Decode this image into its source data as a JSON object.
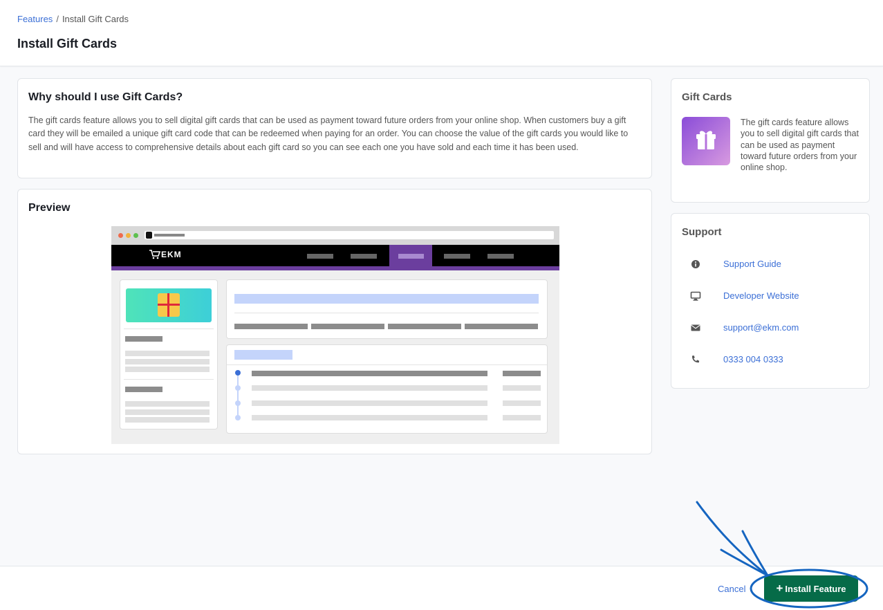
{
  "breadcrumb": {
    "parent": "Features",
    "separator": "/",
    "current": "Install Gift Cards"
  },
  "page_title": "Install Gift Cards",
  "why": {
    "title": "Why should I use Gift Cards?",
    "body": "The gift cards feature allows you to sell digital gift cards that can be used as payment toward future orders from your online shop. When customers buy a gift card they will be emailed a unique gift card code that can be redeemed when paying for an order. You can choose the value of the gift cards you would like to sell and will have access to comprehensive details about each gift card so you can see each one you have sold and each time it has been used."
  },
  "preview": {
    "title": "Preview",
    "logo_text": "⬚EKM"
  },
  "feature_card": {
    "title": "Gift Cards",
    "description": "The gift cards feature allows you to sell digital gift cards that can be used as payment toward future orders from your online shop.",
    "icon": "gift-icon"
  },
  "support": {
    "title": "Support",
    "items": [
      {
        "icon": "info-icon",
        "label": "Support Guide"
      },
      {
        "icon": "monitor-icon",
        "label": "Developer Website"
      },
      {
        "icon": "envelope-icon",
        "label": "support@ekm.com"
      },
      {
        "icon": "phone-icon",
        "label": "0333 004 0333"
      }
    ]
  },
  "footer": {
    "cancel_label": "Cancel",
    "install_label": "Install Feature"
  },
  "colors": {
    "accent": "#066b48",
    "link": "#3b6fd6",
    "annotation": "#1565c0"
  }
}
